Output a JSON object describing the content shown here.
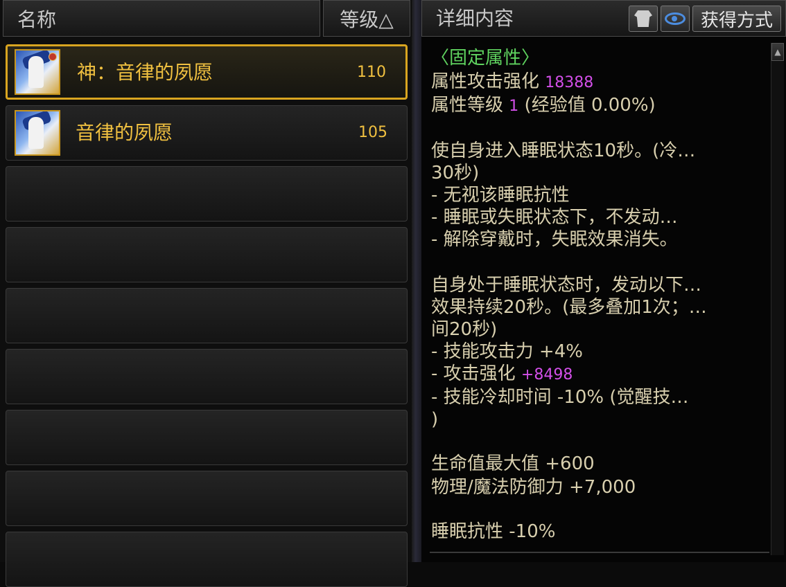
{
  "list_header": {
    "name_label": "名称",
    "level_label": "等级△"
  },
  "items": [
    {
      "name": "神：音律的夙愿",
      "level": "110",
      "selected": true
    },
    {
      "name": "音律的夙愿",
      "level": "105",
      "selected": false
    }
  ],
  "empty_rows": 7,
  "detail_header": {
    "title": "详细内容",
    "armor_icon": "armor-icon",
    "eye_icon": "eye-icon",
    "obtain_label": "获得方式"
  },
  "detail": {
    "section_title": "〈固定属性〉",
    "attr_attack_label": "属性攻击强化",
    "attr_attack_value": "18388",
    "attr_level_label": "属性等级",
    "attr_level_value": "1",
    "attr_exp_text": "(经验值 0.00%)",
    "effect1_line1": "使自身进入睡眠状态10秒。(冷…",
    "effect1_line2": "30秒)",
    "effect1_line3": "- 无视该睡眠抗性",
    "effect1_line4": "- 睡眠或失眠状态下，不发动…",
    "effect1_line5": "- 解除穿戴时，失眠效果消失。",
    "effect2_line1": "自身处于睡眠状态时，发动以下…",
    "effect2_line2": "效果持续20秒。(最多叠加1次；…",
    "effect2_line3": "间20秒)",
    "effect2_skill_attack": "- 技能攻击力 +4%",
    "effect2_attack_label": "- 攻击强化",
    "effect2_attack_value": "+8498",
    "effect2_cooldown": "- 技能冷却时间 -10% (觉醒技…",
    "effect2_close": ")",
    "hp_text": "生命值最大值 +600",
    "defense_text": "物理/魔法防御力 +7,000",
    "sleep_resist_text": "睡眠抗性 -10%"
  }
}
